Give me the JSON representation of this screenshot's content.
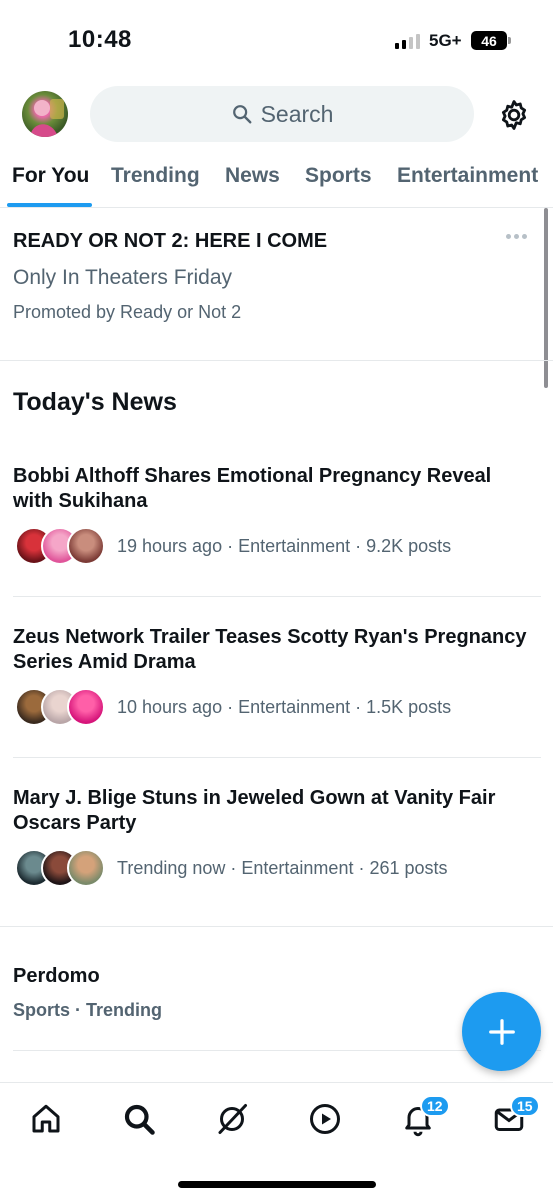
{
  "status_bar": {
    "time": "10:48",
    "network": "5G+",
    "battery": "46"
  },
  "header": {
    "search_placeholder": "Search",
    "avatar_icon": "profile-avatar",
    "settings_icon": "gear-icon"
  },
  "tabs": [
    "For You",
    "Trending",
    "News",
    "Sports",
    "Entertainment"
  ],
  "active_tab": "For You",
  "promoted": {
    "title": "READY OR NOT 2: HERE I COME",
    "subtitle": "Only In Theaters Friday",
    "promoted_by": "Promoted by Ready or Not 2"
  },
  "section_title": "Today's News",
  "news": [
    {
      "title": "Bobbi Althoff Shares Emotional Pregnancy Reveal with Sukihana",
      "meta": "19 hours ago · Entertainment · 9.2K posts"
    },
    {
      "title": "Zeus Network Trailer Teases Scotty Ryan's Pregnancy Series Amid Drama",
      "meta": "10 hours ago · Entertainment · 1.5K posts"
    },
    {
      "title": "Mary J. Blige Stuns in Jeweled Gown at Vanity Fair Oscars Party",
      "meta": "Trending now · Entertainment · 261 posts"
    }
  ],
  "trend": {
    "title": "Perdomo",
    "meta": "Sports · Trending"
  },
  "bottom_nav": {
    "icons": [
      "home-icon",
      "search-icon",
      "grok-icon",
      "video-icon",
      "notifications-icon",
      "messages-icon"
    ],
    "notifications_badge": "12",
    "messages_badge": "15"
  },
  "colors": {
    "accent": "#1d9bf0",
    "secondary_text": "#536471",
    "primary_text": "#0f1419"
  }
}
